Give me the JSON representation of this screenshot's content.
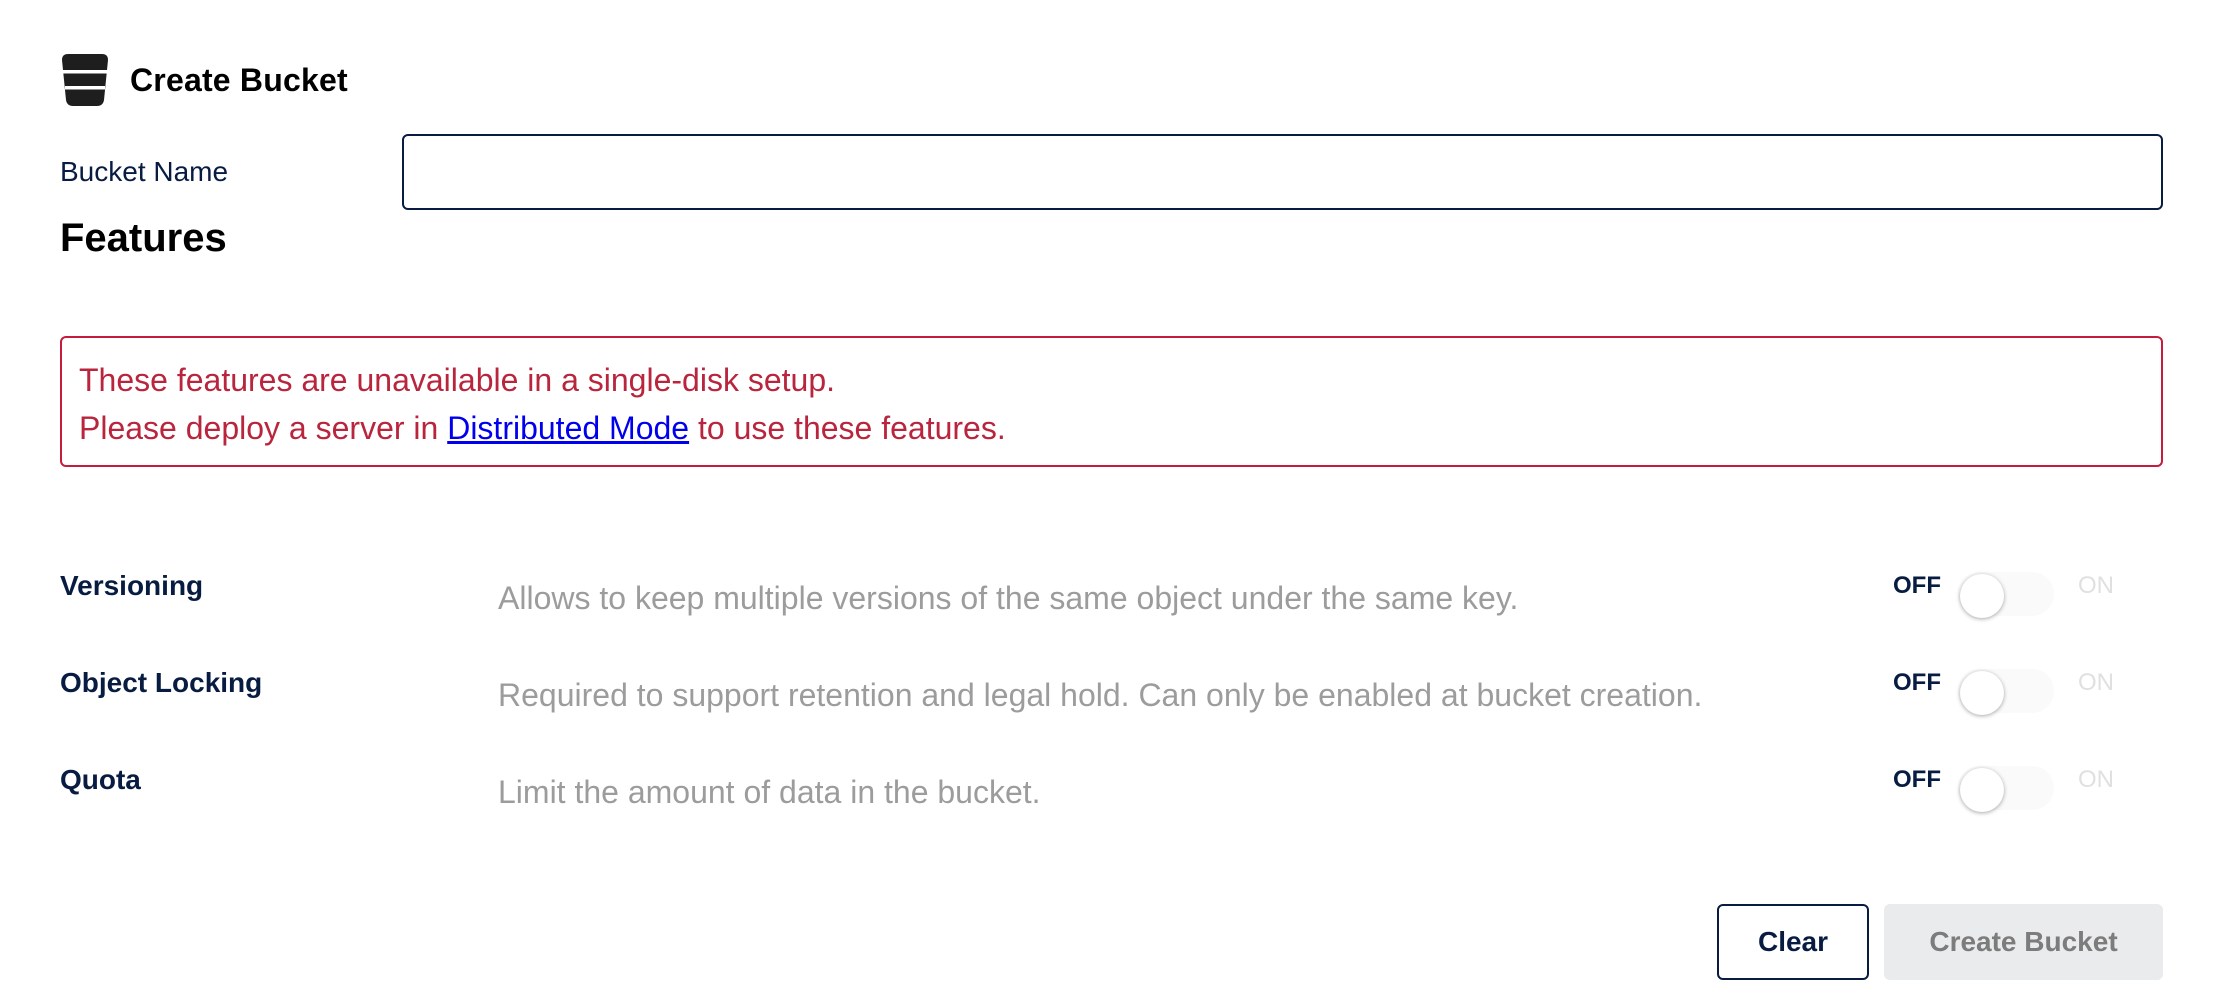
{
  "header": {
    "icon": "bucket-icon",
    "title": "Create Bucket"
  },
  "form": {
    "bucket_name_label": "Bucket Name",
    "bucket_name_value": "",
    "bucket_name_placeholder": ""
  },
  "features": {
    "title": "Features",
    "warning": {
      "line1": "These features are unavailable in a single-disk setup.",
      "line2_before": "Please deploy a server in ",
      "link_text": "Distributed Mode",
      "line2_after": " to use these features."
    },
    "items": [
      {
        "name": "Versioning",
        "description": "Allows to keep multiple versions of the same object under the same key.",
        "off_label": "OFF",
        "on_label": "ON",
        "enabled": false
      },
      {
        "name": "Object Locking",
        "description": "Required to support retention and legal hold. Can only be enabled at bucket creation.",
        "off_label": "OFF",
        "on_label": "ON",
        "enabled": false
      },
      {
        "name": "Quota",
        "description": "Limit the amount of data in the bucket.",
        "off_label": "OFF",
        "on_label": "ON",
        "enabled": false
      }
    ]
  },
  "actions": {
    "clear_label": "Clear",
    "create_label": "Create Bucket"
  },
  "colors": {
    "primary_text": "#081c42",
    "warning": "#b8253d",
    "link": "#0000ee",
    "disabled_button_bg": "#e9ebec"
  }
}
